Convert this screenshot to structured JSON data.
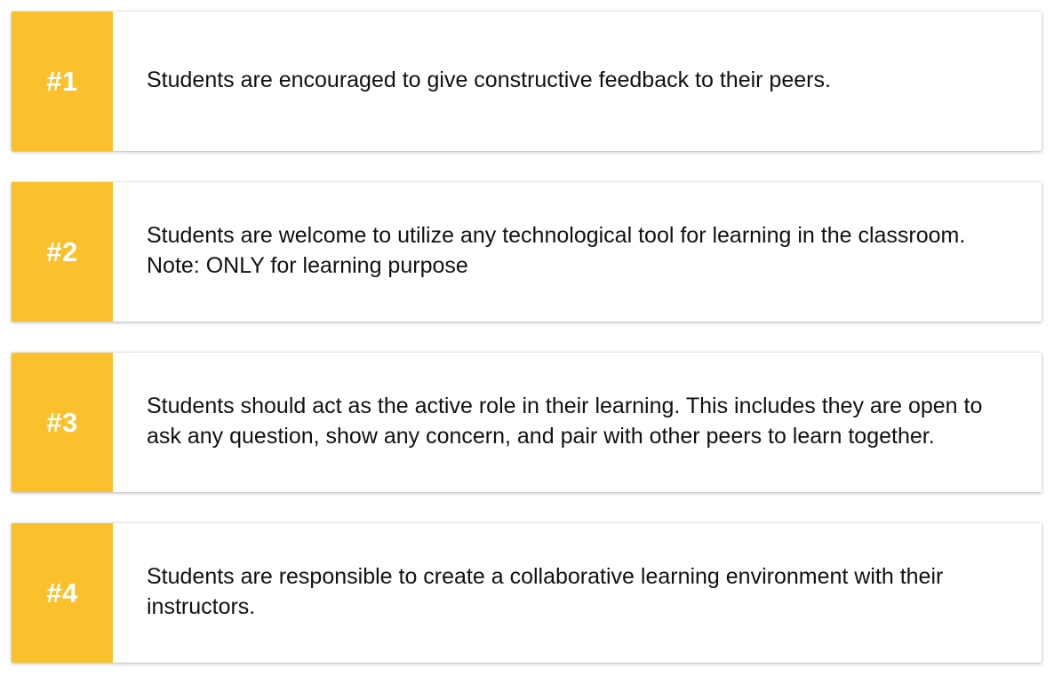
{
  "colors": {
    "accent": "#FBC12D",
    "card_background": "#FFFFFF",
    "text": "#111111"
  },
  "items": [
    {
      "number": "#1",
      "text": "Students are encouraged to give constructive feedback to their peers."
    },
    {
      "number": "#2",
      "text": "Students are welcome to utilize any technological tool for learning in the classroom. Note: ONLY for learning purpose"
    },
    {
      "number": "#3",
      "text": "Students should act as the active role in their learning. This includes they are open to ask any question, show any concern, and pair with other peers to learn together."
    },
    {
      "number": "#4",
      "text": "Students are responsible to create a collaborative learning environment with their instructors."
    }
  ]
}
